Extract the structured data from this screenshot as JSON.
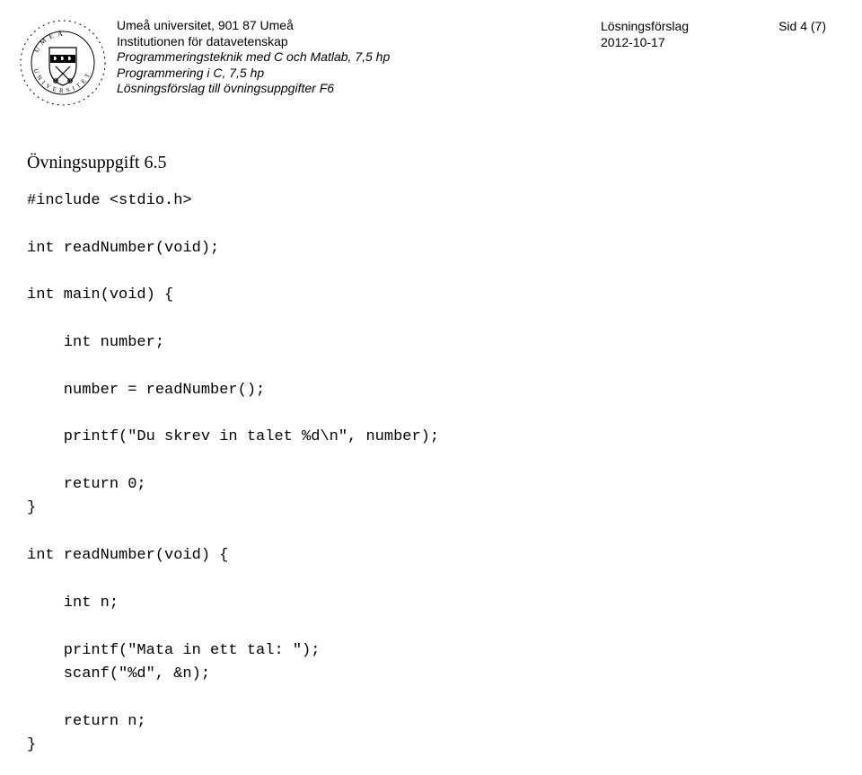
{
  "header": {
    "university": "Umeå universitet, 901 87 Umeå",
    "department": "Institutionen för datavetenskap",
    "course1": "Programmeringsteknik med C och Matlab, 7,5 hp",
    "course2": "Programmering i C, 7,5 hp",
    "docline": "Lösningsförslag till övningsuppgifter F6",
    "right_title": "Lösningsförslag",
    "right_date": "2012-10-17",
    "page_label": "Sid 4 (7)"
  },
  "exercise": {
    "title": "Övningsuppgift 6.5"
  },
  "code": {
    "l01": "#include <stdio.h>",
    "l02": "",
    "l03": "int readNumber(void);",
    "l04": "",
    "l05": "int main(void) {",
    "l06": "",
    "l07": "    int number;",
    "l08": "",
    "l09": "    number = readNumber();",
    "l10": "",
    "l11": "    printf(\"Du skrev in talet %d\\n\", number);",
    "l12": "",
    "l13": "    return 0;",
    "l14": "}",
    "l15": "",
    "l16": "int readNumber(void) {",
    "l17": "",
    "l18": "    int n;",
    "l19": "",
    "l20": "    printf(\"Mata in ett tal: \");",
    "l21": "    scanf(\"%d\", &n);",
    "l22": "",
    "l23": "    return n;",
    "l24": "}"
  }
}
